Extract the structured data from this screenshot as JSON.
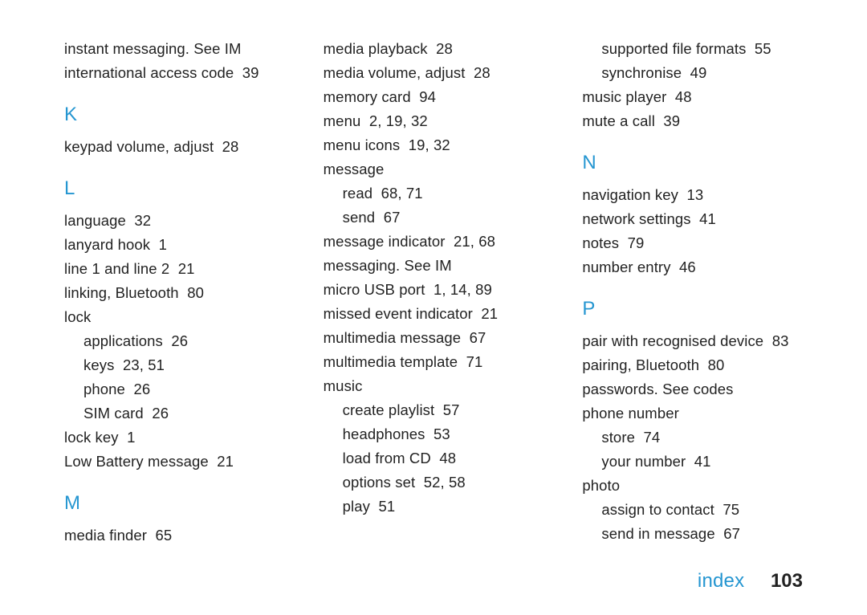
{
  "footer": {
    "section": "index",
    "page_number": "103"
  },
  "col1": {
    "pre": [
      {
        "text": "instant messaging. See IM",
        "pages": ""
      },
      {
        "text": "international access code",
        "pages": "39"
      }
    ],
    "K": {
      "letter": "K",
      "items": [
        {
          "text": "keypad volume, adjust",
          "pages": "28"
        }
      ]
    },
    "L": {
      "letter": "L",
      "items": [
        {
          "text": "language",
          "pages": "32"
        },
        {
          "text": "lanyard hook",
          "pages": "1"
        },
        {
          "text": "line 1 and line 2",
          "pages": "21"
        },
        {
          "text": "linking, Bluetooth",
          "pages": "80"
        },
        {
          "text": "lock",
          "pages": ""
        },
        {
          "text": "applications",
          "pages": "26",
          "sub": true
        },
        {
          "text": "keys",
          "pages": "23, 51",
          "sub": true
        },
        {
          "text": "phone",
          "pages": "26",
          "sub": true
        },
        {
          "text": "SIM card",
          "pages": "26",
          "sub": true
        },
        {
          "text": "lock key",
          "pages": "1"
        },
        {
          "text": "Low Battery message",
          "pages": "21"
        }
      ]
    },
    "M": {
      "letter": "M",
      "items": [
        {
          "text": "media finder",
          "pages": "65"
        }
      ]
    }
  },
  "col2": {
    "items": [
      {
        "text": "media playback",
        "pages": "28"
      },
      {
        "text": "media volume, adjust",
        "pages": "28"
      },
      {
        "text": "memory card",
        "pages": "94"
      },
      {
        "text": "menu",
        "pages": "2, 19, 32"
      },
      {
        "text": "menu icons",
        "pages": "19, 32"
      },
      {
        "text": "message",
        "pages": ""
      },
      {
        "text": "read",
        "pages": "68, 71",
        "sub": true
      },
      {
        "text": "send",
        "pages": "67",
        "sub": true
      },
      {
        "text": "message indicator",
        "pages": "21, 68"
      },
      {
        "text": "messaging. See IM",
        "pages": ""
      },
      {
        "text": "micro USB port",
        "pages": "1, 14, 89"
      },
      {
        "text": "missed event indicator",
        "pages": "21"
      },
      {
        "text": "multimedia message",
        "pages": "67"
      },
      {
        "text": "multimedia template",
        "pages": "71"
      },
      {
        "text": "music",
        "pages": ""
      },
      {
        "text": "create playlist",
        "pages": "57",
        "sub": true
      },
      {
        "text": "headphones",
        "pages": "53",
        "sub": true
      },
      {
        "text": "load from CD",
        "pages": "48",
        "sub": true
      },
      {
        "text": "options set",
        "pages": "52, 58",
        "sub": true
      },
      {
        "text": "play",
        "pages": "51",
        "sub": true
      }
    ]
  },
  "col3": {
    "pre": [
      {
        "text": "supported file formats",
        "pages": "55",
        "sub": true
      },
      {
        "text": "synchronise",
        "pages": "49",
        "sub": true
      },
      {
        "text": "music player",
        "pages": "48"
      },
      {
        "text": "mute a call",
        "pages": "39"
      }
    ],
    "N": {
      "letter": "N",
      "items": [
        {
          "text": "navigation key",
          "pages": "13"
        },
        {
          "text": "network settings",
          "pages": "41"
        },
        {
          "text": "notes",
          "pages": "79"
        },
        {
          "text": "number entry",
          "pages": "46"
        }
      ]
    },
    "P": {
      "letter": "P",
      "items": [
        {
          "text": "pair with recognised device",
          "pages": "83"
        },
        {
          "text": "pairing, Bluetooth",
          "pages": "80"
        },
        {
          "text": "passwords. See codes",
          "pages": ""
        },
        {
          "text": "phone number",
          "pages": ""
        },
        {
          "text": "store",
          "pages": "74",
          "sub": true
        },
        {
          "text": "your number",
          "pages": "41",
          "sub": true
        },
        {
          "text": "photo",
          "pages": ""
        },
        {
          "text": "assign to contact",
          "pages": "75",
          "sub": true
        },
        {
          "text": "send in message",
          "pages": "67",
          "sub": true
        }
      ]
    }
  }
}
